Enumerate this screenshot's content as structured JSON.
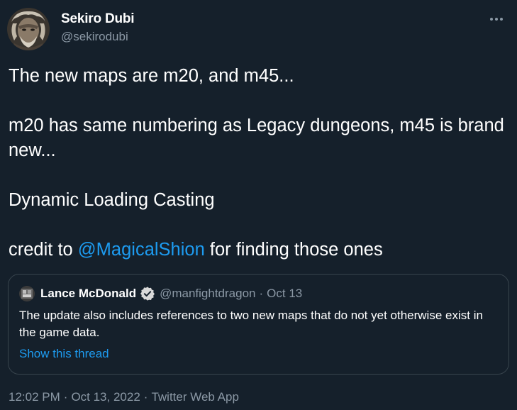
{
  "author": {
    "display_name": "Sekiro Dubi",
    "handle": "@sekirodubi"
  },
  "tweet": {
    "line1": "The new maps are m20, and m45...",
    "line2": "m20 has same numbering as Legacy dungeons, m45 is brand new...",
    "line3": "Dynamic Loading Casting",
    "credit_prefix": "credit to ",
    "credit_mention": "@MagicalShion",
    "credit_suffix": " for finding those ones"
  },
  "quote": {
    "display_name": "Lance McDonald",
    "handle": "@manfightdragon",
    "separator": "·",
    "date": "Oct 13",
    "text": "The update also includes references to two new maps that do not yet otherwise exist in the game data.",
    "show_thread": "Show this thread"
  },
  "meta": {
    "time": "12:02 PM",
    "separator": "·",
    "date": "Oct 13, 2022",
    "source": "Twitter Web App"
  },
  "colors": {
    "background": "#15202b",
    "link": "#1d9bf0",
    "secondary_text": "#8b98a5",
    "border": "#38444d"
  },
  "icons": {
    "more": "more-dots-icon",
    "verified": "verified-badge-icon"
  }
}
